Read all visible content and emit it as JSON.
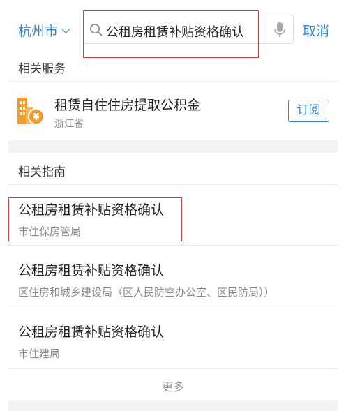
{
  "header": {
    "city": "杭州市",
    "search_query": "公租房租赁补贴资格确认",
    "cancel_label": "取消"
  },
  "services": {
    "title": "相关服务",
    "item": {
      "name": "租赁自住住房提取公积金",
      "region": "浙江省",
      "subscribe_label": "订阅",
      "icon": "building-yuan-icon",
      "icon_color": "#f29b2a"
    }
  },
  "guides": {
    "title": "相关指南",
    "items": [
      {
        "title": "公租房租赁补贴资格确认",
        "dept": "市住保房管局"
      },
      {
        "title": "公租房租赁补贴资格确认",
        "dept": "区住房和城乡建设局（区人民防空办公室、区民防局））"
      },
      {
        "title": "公租房租赁补贴资格确认",
        "dept": "市住建局"
      }
    ],
    "more_label": "更多"
  },
  "colors": {
    "accent": "#2f86d7",
    "highlight": "#e23a3a"
  }
}
